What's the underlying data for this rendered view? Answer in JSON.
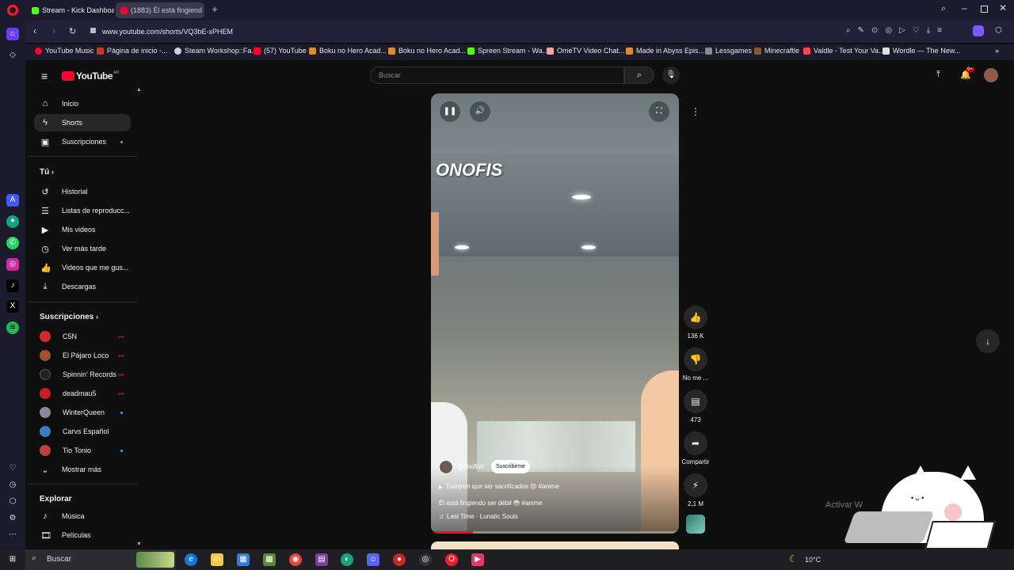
{
  "browser": {
    "tabs": [
      {
        "label": "Stream - Kick Dashboard",
        "color": "#53fc18"
      },
      {
        "label": "(1883) Él está fingiend",
        "color": "#ff0033"
      }
    ],
    "address": "www.youtube.com/shorts/VQ3bE-xPHEM",
    "bookmarks": [
      "YouTube Music",
      "Página de inicio -...",
      "Steam Workshop::Fa...",
      "(57) YouTube",
      "Boku no Hero Acad...",
      "Boku no Hero Acad...",
      "Spreen Stream - Wa...",
      "OmeTV Video Chat...",
      "Made in Abyss Epis...",
      "Lessgames",
      "Minecraftle",
      "Valdle - Test Your Va...",
      "Wordle — The New..."
    ]
  },
  "youtube": {
    "logo_text": "YouTube",
    "logo_region": "AR",
    "search_placeholder": "Buscar",
    "notif_badge": "9+",
    "nav": {
      "main": [
        "Inicio",
        "Shorts",
        "Suscripciones"
      ],
      "you_title": "Tú",
      "you_items": [
        "Historial",
        "Listas de reproducc...",
        "Mis videos",
        "Ver más tarde",
        "Videos que me gus...",
        "Descargas"
      ],
      "subs_title": "Suscripciones",
      "subs": [
        {
          "name": "C5N",
          "color": "#d62828"
        },
        {
          "name": "El Pájaro Loco",
          "color": "#a0522d"
        },
        {
          "name": "Spinnin' Records",
          "color": "#222222"
        },
        {
          "name": "deadmau5",
          "color": "#c81d25"
        },
        {
          "name": "WinterQueen",
          "color": "#8a8a9a"
        },
        {
          "name": "Carvs Español",
          "color": "#3b7bbf"
        },
        {
          "name": "Tio Tonio",
          "color": "#c04040"
        }
      ],
      "show_more": "Mostrar más",
      "explore_title": "Explorar",
      "explore_items": [
        "Música",
        "Películas"
      ]
    },
    "short": {
      "overlay_text": "ONOFIS",
      "channel": "@onofis6",
      "subscribe_label": "Suscribirme",
      "hashtag_line": "Tuvieron que ser sacrificados 😢 #anime",
      "title": "Él está fingiendo ser débil 😳 #anime",
      "song": "Last Time · Lunatic Souls",
      "likes": "136 K",
      "dislike_label": "No me ...",
      "comments": "473",
      "share_label": "Compartir",
      "remix_count": "2,1 M"
    },
    "watermark": "Activar W"
  },
  "taskbar": {
    "search_label": "Buscar",
    "temperature": "10°C"
  }
}
